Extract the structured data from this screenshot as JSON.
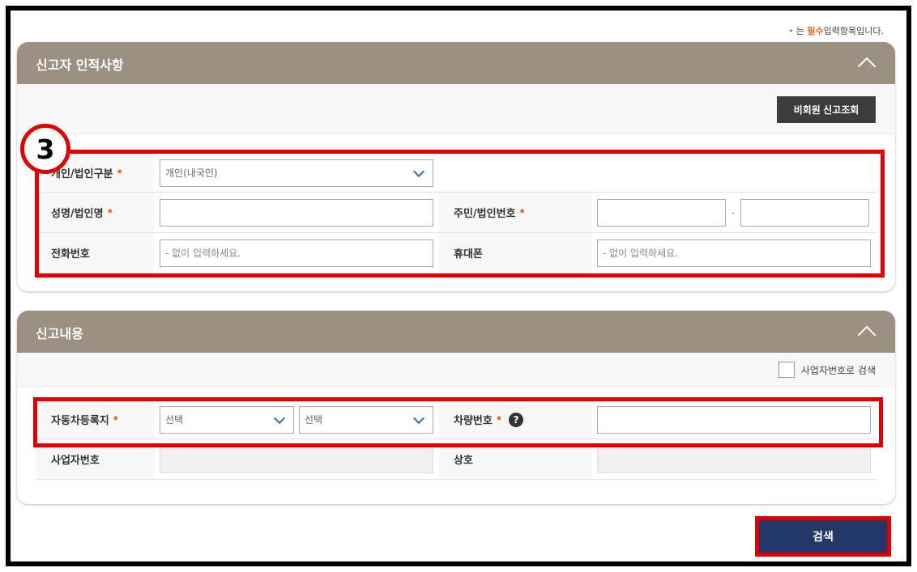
{
  "required_note": {
    "prefix": "는",
    "bold": "필수",
    "suffix": "입력항목입니다."
  },
  "panel1": {
    "title": "신고자 인적사항",
    "lookup_button": "비회원 신고조회",
    "badge": "3",
    "rows": {
      "type_label": "개인/법인구분",
      "type_value": "개인(내국인)",
      "name_label": "성명/법인명",
      "id_label": "주민/법인번호",
      "id_separator": "-",
      "phone_label": "전화번호",
      "phone_placeholder": "- 없이 입력하세요.",
      "mobile_label": "휴대폰",
      "mobile_placeholder": "- 없이 입력하세요."
    }
  },
  "panel2": {
    "title": "신고내용",
    "checkbox_label": "사업자번호로 검색",
    "rows": {
      "region_label": "자동차등록지",
      "region_select1": "선택",
      "region_select2": "선택",
      "plate_label": "차량번호",
      "help": "?",
      "biz_label": "사업자번호",
      "company_label": "상호"
    }
  },
  "search_button": "검색",
  "required_dot": "•",
  "colors": {
    "header": "#9b9081",
    "accent": "#e8692a",
    "highlight": "#e30000",
    "primary": "#24376b"
  }
}
